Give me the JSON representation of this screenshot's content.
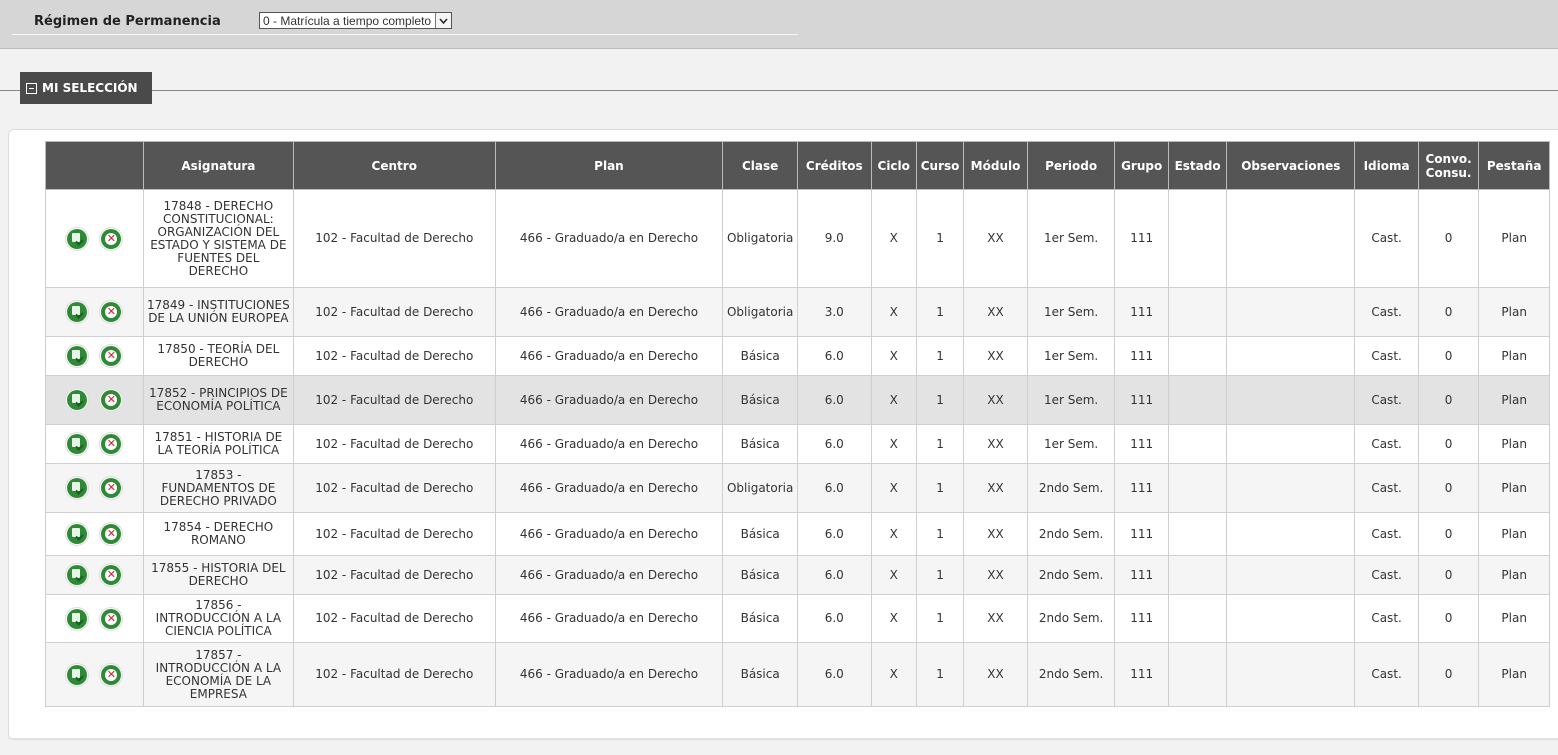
{
  "regimen": {
    "label": "Régimen de Permanencia",
    "selected": "0 - Matrícula a tiempo completo"
  },
  "section": {
    "title": "MI SELECCIÓN"
  },
  "table": {
    "headers": [
      "",
      "Asignatura",
      "Centro",
      "Plan",
      "Clase",
      "Créditos",
      "Ciclo",
      "Curso",
      "Módulo",
      "Periodo",
      "Grupo",
      "Estado",
      "Observaciones",
      "Idioma",
      "Convo. Consu.",
      "Pestaña"
    ],
    "rows": [
      {
        "asignatura": "17848 - DERECHO CONSTITUCIONAL: ORGANIZACIÓN DEL ESTADO Y SISTEMA DE FUENTES DEL DERECHO",
        "centro": "102 - Facultad de Derecho",
        "plan": "466 - Graduado/a en Derecho",
        "clase": "Obligatoria",
        "creditos": "9.0",
        "ciclo": "X",
        "curso": "1",
        "modulo": "XX",
        "periodo": "1er Sem.",
        "grupo": "111",
        "estado": "",
        "observaciones": "",
        "idioma": "Cast.",
        "convo": "0",
        "pestana": "Plan"
      },
      {
        "asignatura": "17849 - INSTITUCIONES DE LA UNIÓN EUROPEA",
        "centro": "102 - Facultad de Derecho",
        "plan": "466 - Graduado/a en Derecho",
        "clase": "Obligatoria",
        "creditos": "3.0",
        "ciclo": "X",
        "curso": "1",
        "modulo": "XX",
        "periodo": "1er Sem.",
        "grupo": "111",
        "estado": "",
        "observaciones": "",
        "idioma": "Cast.",
        "convo": "0",
        "pestana": "Plan"
      },
      {
        "asignatura": "17850 - TEORÍA DEL DERECHO",
        "centro": "102 - Facultad de Derecho",
        "plan": "466 - Graduado/a en Derecho",
        "clase": "Básica",
        "creditos": "6.0",
        "ciclo": "X",
        "curso": "1",
        "modulo": "XX",
        "periodo": "1er Sem.",
        "grupo": "111",
        "estado": "",
        "observaciones": "",
        "idioma": "Cast.",
        "convo": "0",
        "pestana": "Plan"
      },
      {
        "asignatura": "17852 - PRINCIPIOS DE ECONOMÍA POLÍTICA",
        "centro": "102 - Facultad de Derecho",
        "plan": "466 - Graduado/a en Derecho",
        "clase": "Básica",
        "creditos": "6.0",
        "ciclo": "X",
        "curso": "1",
        "modulo": "XX",
        "periodo": "1er Sem.",
        "grupo": "111",
        "estado": "",
        "observaciones": "",
        "idioma": "Cast.",
        "convo": "0",
        "pestana": "Plan"
      },
      {
        "asignatura": "17851 - HISTORIA DE LA TEORÍA POLÍTICA",
        "centro": "102 - Facultad de Derecho",
        "plan": "466 - Graduado/a en Derecho",
        "clase": "Básica",
        "creditos": "6.0",
        "ciclo": "X",
        "curso": "1",
        "modulo": "XX",
        "periodo": "1er Sem.",
        "grupo": "111",
        "estado": "",
        "observaciones": "",
        "idioma": "Cast.",
        "convo": "0",
        "pestana": "Plan"
      },
      {
        "asignatura": "17853 - FUNDAMENTOS DE DERECHO PRIVADO",
        "centro": "102 - Facultad de Derecho",
        "plan": "466 - Graduado/a en Derecho",
        "clase": "Obligatoria",
        "creditos": "6.0",
        "ciclo": "X",
        "curso": "1",
        "modulo": "XX",
        "periodo": "2ndo Sem.",
        "grupo": "111",
        "estado": "",
        "observaciones": "",
        "idioma": "Cast.",
        "convo": "0",
        "pestana": "Plan"
      },
      {
        "asignatura": "17854 - DERECHO ROMANO",
        "centro": "102 - Facultad de Derecho",
        "plan": "466 - Graduado/a en Derecho",
        "clase": "Básica",
        "creditos": "6.0",
        "ciclo": "X",
        "curso": "1",
        "modulo": "XX",
        "periodo": "2ndo Sem.",
        "grupo": "111",
        "estado": "",
        "observaciones": "",
        "idioma": "Cast.",
        "convo": "0",
        "pestana": "Plan"
      },
      {
        "asignatura": "17855 - HISTORIA DEL DERECHO",
        "centro": "102 - Facultad de Derecho",
        "plan": "466 - Graduado/a en Derecho",
        "clase": "Básica",
        "creditos": "6.0",
        "ciclo": "X",
        "curso": "1",
        "modulo": "XX",
        "periodo": "2ndo Sem.",
        "grupo": "111",
        "estado": "",
        "observaciones": "",
        "idioma": "Cast.",
        "convo": "0",
        "pestana": "Plan"
      },
      {
        "asignatura": "17856 - INTRODUCCIÓN A LA CIENCIA POLÍTICA",
        "centro": "102 - Facultad de Derecho",
        "plan": "466 - Graduado/a en Derecho",
        "clase": "Básica",
        "creditos": "6.0",
        "ciclo": "X",
        "curso": "1",
        "modulo": "XX",
        "periodo": "2ndo Sem.",
        "grupo": "111",
        "estado": "",
        "observaciones": "",
        "idioma": "Cast.",
        "convo": "0",
        "pestana": "Plan"
      },
      {
        "asignatura": "17857 - INTRODUCCIÓN A LA ECONOMÍA DE LA EMPRESA",
        "centro": "102 - Facultad de Derecho",
        "plan": "466 - Graduado/a en Derecho",
        "clase": "Básica",
        "creditos": "6.0",
        "ciclo": "X",
        "curso": "1",
        "modulo": "XX",
        "periodo": "2ndo Sem.",
        "grupo": "111",
        "estado": "",
        "observaciones": "",
        "idioma": "Cast.",
        "convo": "0",
        "pestana": "Plan"
      }
    ]
  },
  "icons": {
    "confirm": "confirm-subject-icon",
    "remove": "remove-subject-icon"
  },
  "colors": {
    "header_bg": "#555555",
    "action_green": "#2f8a37",
    "remove_red": "#d2232a",
    "highlight_row": "#e3e3e3"
  }
}
